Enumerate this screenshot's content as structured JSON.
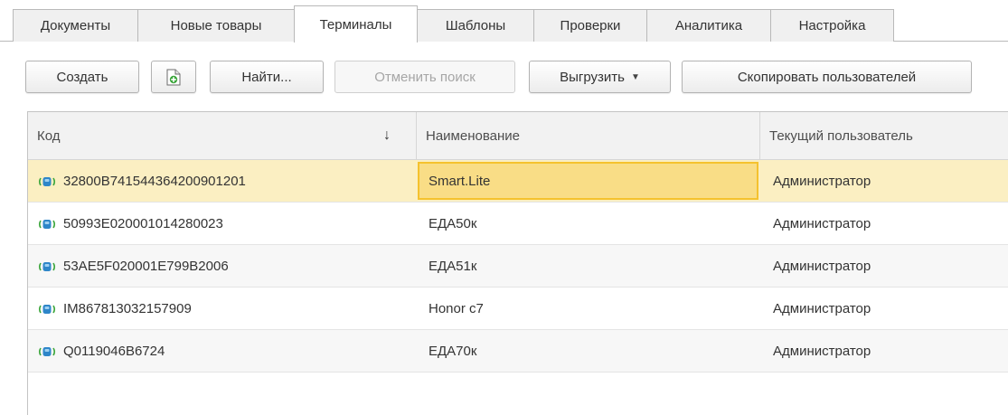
{
  "tabs": [
    {
      "label": "Документы",
      "active": false
    },
    {
      "label": "Новые товары",
      "active": false
    },
    {
      "label": "Терминалы",
      "active": true
    },
    {
      "label": "Шаблоны",
      "active": false
    },
    {
      "label": "Проверки",
      "active": false
    },
    {
      "label": "Аналитика",
      "active": false
    },
    {
      "label": "Настройка",
      "active": false
    }
  ],
  "toolbar": {
    "create_label": "Создать",
    "copy_icon": "add-document-icon",
    "find_label": "Найти...",
    "cancel_search_label": "Отменить поиск",
    "export_label": "Выгрузить",
    "copy_users_label": "Скопировать пользователей"
  },
  "table": {
    "columns": [
      "Код",
      "Наименование",
      "Текущий пользователь"
    ],
    "sort_indicator": "↓",
    "rows": [
      {
        "code": "32800B741544364200901201",
        "name": "Smart.Lite",
        "user": "Администратор"
      },
      {
        "code": "50993E020001014280023",
        "name": "ЕДА50к",
        "user": "Администратор"
      },
      {
        "code": "53AE5F020001E799B2006",
        "name": "ЕДА51к",
        "user": "Администратор"
      },
      {
        "code": "IM867813032157909",
        "name": "Honor c7",
        "user": "Администратор"
      },
      {
        "code": "Q0119046B6724",
        "name": "ЕДА70к",
        "user": "Администратор"
      }
    ],
    "selected_row": 0
  },
  "colors": {
    "selected_row": "#fbefc2",
    "focused_cell": "#f9dd86",
    "icon_blue": "#2e86c9",
    "icon_green": "#3aa53a"
  }
}
